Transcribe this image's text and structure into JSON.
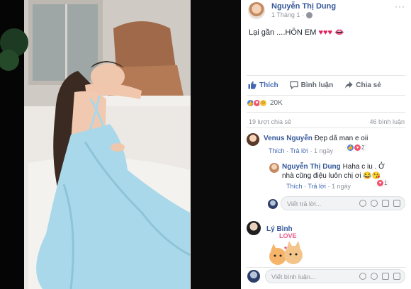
{
  "post": {
    "author": "Nguyễn Thị Dung",
    "time": "1 Tháng 1",
    "caption_text": "Lại gần ....HÔN EM ",
    "caption_hearts": "♥♥♥",
    "caption_lips": "👄",
    "more": "···"
  },
  "actions": {
    "like": "Thích",
    "comment": "Bình luận",
    "share": "Chia sẻ",
    "like_active": true
  },
  "reactions": {
    "count": "20K",
    "types": [
      "like-icon",
      "love-icon",
      "haha-icon"
    ]
  },
  "stats": {
    "shares": "19 lượt chia sẻ",
    "comments": "46 bình luận"
  },
  "comments": [
    {
      "name": "Venus Nguyễn",
      "text": "Đẹp dã man e oii",
      "like": "Thích",
      "reply": "Trả lời",
      "time": "1 ngày",
      "reaction_count": "2"
    },
    {
      "name": "Nguyễn Thị Dung",
      "text_line1": "Haha c iu . Ở",
      "text_line2": "nhà cũng điệu luôn chị ơi 😂😘",
      "like": "Thích",
      "reply": "Trả lời",
      "time": "1 ngày",
      "reaction_count": "1"
    },
    {
      "name": "Lý Bình",
      "sticker_text": "LOVE"
    }
  ],
  "reply_input": {
    "placeholder": "Viết trả lời..."
  },
  "comment_input": {
    "placeholder": "Viết bình luận..."
  },
  "colors": {
    "link": "#365899",
    "accent": "#4267b2",
    "muted": "#90949c",
    "dress": "#a9d8ea"
  }
}
